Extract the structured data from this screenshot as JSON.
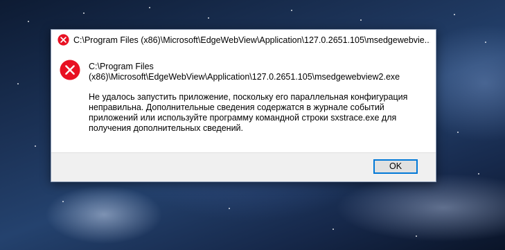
{
  "dialog": {
    "title": "C:\\Program Files (x86)\\Microsoft\\EdgeWebView\\Application\\127.0.2651.105\\msedgewebvie...",
    "path_line1": "C:\\Program Files",
    "path_line2": "(x86)\\Microsoft\\EdgeWebView\\Application\\127.0.2651.105\\msedgewebview2.exe",
    "message": "Не удалось запустить приложение, поскольку его параллельная конфигурация неправильна. Дополнительные сведения содержатся в журнале событий приложений или используйте программу командной строки sxstrace.exe для получения дополнительных сведений.",
    "ok_label": "OK",
    "icon": "error-icon"
  },
  "colors": {
    "error_red": "#e81123",
    "accent": "#0078d7",
    "footer_bg": "#f0f0f0"
  }
}
